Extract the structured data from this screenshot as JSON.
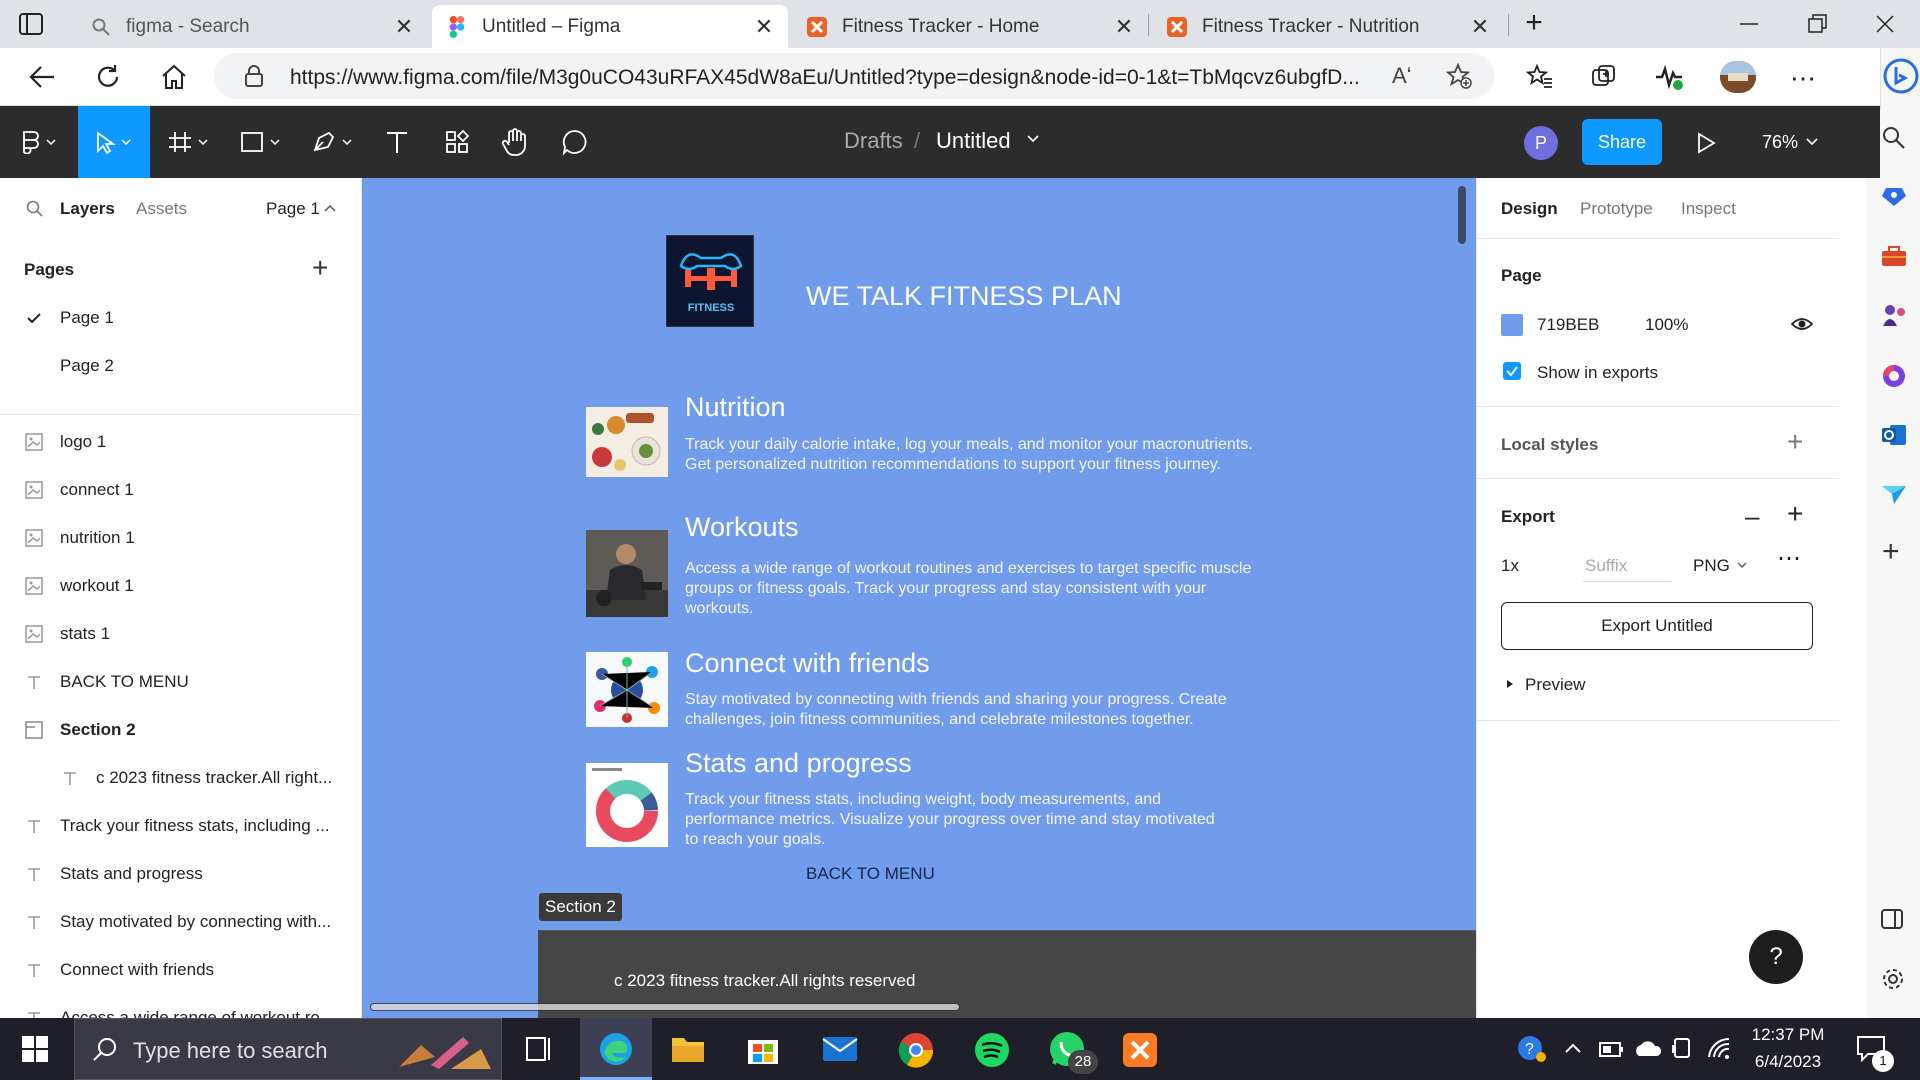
{
  "browser": {
    "tabs": [
      {
        "title": "figma - Search",
        "icon": "search-icon"
      },
      {
        "title": "Untitled – Figma",
        "icon": "figma-icon",
        "active": true
      },
      {
        "title": "Fitness Tracker - Home",
        "icon": "app-icon"
      },
      {
        "title": "Fitness Tracker - Nutrition",
        "icon": "app-icon"
      }
    ],
    "url": "https://www.figma.com/file/M3g0uCO43uRFAX45dW8aEu/Untitled?type=design&node-id=0-1&t=TbMqcvz6ubgfD...",
    "read_aloud_label": "Aʻ"
  },
  "figma": {
    "breadcrumb": {
      "parent": "Drafts",
      "separator": "/",
      "file": "Untitled"
    },
    "avatar_initial": "P",
    "share_label": "Share",
    "zoom": "76%",
    "left_panel": {
      "tabs": {
        "layers": "Layers",
        "assets": "Assets",
        "page": "Page 1"
      },
      "pages_title": "Pages",
      "pages": [
        "Page 1",
        "Page 2"
      ],
      "layers": [
        {
          "type": "image",
          "name": "logo 1"
        },
        {
          "type": "image",
          "name": "connect 1"
        },
        {
          "type": "image",
          "name": "nutrition 1"
        },
        {
          "type": "image",
          "name": "workout 1"
        },
        {
          "type": "image",
          "name": "stats 1"
        },
        {
          "type": "text",
          "name": "BACK TO MENU"
        },
        {
          "type": "section",
          "name": "Section 2"
        },
        {
          "type": "text",
          "name": "c 2023 fitness tracker.All right..."
        },
        {
          "type": "text",
          "name": "Track your fitness stats, including ..."
        },
        {
          "type": "text",
          "name": "Stats and progress"
        },
        {
          "type": "text",
          "name": "Stay motivated by connecting with..."
        },
        {
          "type": "text",
          "name": "Connect with friends"
        },
        {
          "type": "text",
          "name": "Access a wide range of workout ro..."
        }
      ]
    },
    "right_panel": {
      "tabs": {
        "design": "Design",
        "prototype": "Prototype",
        "inspect": "Inspect"
      },
      "page_title": "Page",
      "page_color": "719BEB",
      "page_opacity": "100%",
      "show_in_exports": "Show in exports",
      "local_styles": "Local styles",
      "export_title": "Export",
      "export_scale": "1x",
      "export_suffix_placeholder": "Suffix",
      "export_format": "PNG",
      "export_button": "Export Untitled",
      "preview": "Preview"
    },
    "canvas": {
      "background": "#719beb",
      "logo_text": "FITNESS",
      "title": "WE TALK FITNESS PLAN",
      "sections": [
        {
          "heading": "Nutrition",
          "body": [
            "Track your daily calorie intake, log your meals, and monitor your macronutrients.",
            "Get personalized nutrition recommendations to support your fitness journey."
          ]
        },
        {
          "heading": "Workouts",
          "body": [
            "Access a wide range of workout routines and exercises to target specific muscle",
            "groups or fitness goals. Track your progress and stay consistent with your",
            "workouts."
          ]
        },
        {
          "heading": "Connect with friends",
          "body": [
            "Stay motivated by connecting with friends and sharing your progress. Create",
            "challenges, join fitness communities, and celebrate milestones together."
          ]
        },
        {
          "heading": "Stats and progress",
          "body": [
            "Track your fitness stats, including weight, body measurements, and",
            "performance metrics. Visualize your progress over time and stay motivated",
            "to reach your goals."
          ]
        }
      ],
      "back_to_menu": "BACK TO MENU",
      "section_label": "Section 2",
      "footer": "c 2023 fitness tracker.All rights reserved"
    }
  },
  "taskbar": {
    "search_placeholder": "Type here to search",
    "whatsapp_badge": "28",
    "time": "12:37 PM",
    "date": "6/4/2023",
    "notification_count": "1"
  }
}
